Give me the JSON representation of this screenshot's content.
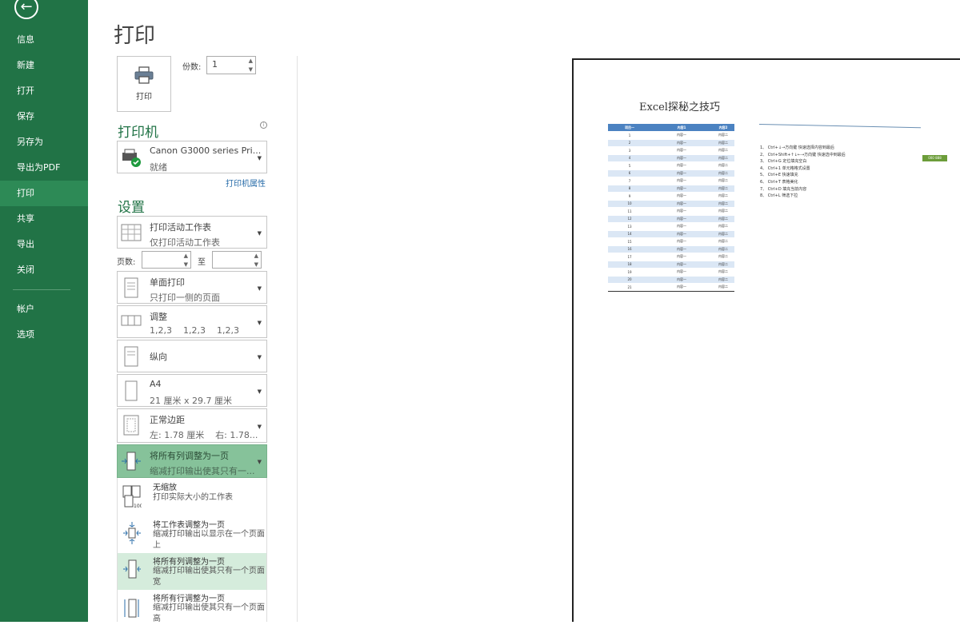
{
  "sidebar": {
    "items": [
      {
        "label": "信息"
      },
      {
        "label": "新建"
      },
      {
        "label": "打开"
      },
      {
        "label": "保存"
      },
      {
        "label": "另存为"
      },
      {
        "label": "导出为PDF"
      },
      {
        "label": "打印",
        "active": true
      },
      {
        "label": "共享"
      },
      {
        "label": "导出"
      },
      {
        "label": "关闭"
      },
      {
        "label": "帐户"
      },
      {
        "label": "选项"
      }
    ]
  },
  "page_title": "打印",
  "print_button_label": "打印",
  "copies": {
    "label": "份数:",
    "value": "1"
  },
  "printer": {
    "section_title": "打印机",
    "name": "Canon G3000 series Pri...",
    "status": "就绪",
    "properties_link": "打印机属性"
  },
  "settings": {
    "section_title": "设置",
    "scope": {
      "title": "打印活动工作表",
      "desc": "仅打印活动工作表"
    },
    "pages_label": "页数:",
    "to_label": "至",
    "sides": {
      "title": "单面打印",
      "desc": "只打印一侧的页面"
    },
    "collate": {
      "title": "调整",
      "desc": "1,2,3    1,2,3    1,2,3"
    },
    "orientation": {
      "title": "纵向"
    },
    "paper": {
      "title": "A4",
      "desc": "21 厘米 x 29.7 厘米"
    },
    "margins": {
      "title": "正常边距",
      "desc": "左: 1.78 厘米    右: 1.78..."
    },
    "scaling": {
      "title": "将所有列调整为一页",
      "desc": "缩减打印输出使其只有一..."
    }
  },
  "scaling_menu": [
    {
      "title": "无缩放",
      "desc": "打印实际大小的工作表"
    },
    {
      "title": "将工作表调整为一页",
      "desc": "缩减打印输出以显示在一个页面上"
    },
    {
      "title": "将所有列调整为一页",
      "desc": "缩减打印输出使其只有一个页面宽",
      "selected": true
    },
    {
      "title": "将所有行调整为一页",
      "desc": "缩减打印输出使其只有一个页面高"
    }
  ],
  "preview": {
    "title": "Excel探秘之技巧",
    "headers": [
      "项目一",
      "内容1",
      "内容2"
    ],
    "rows": [
      [
        "1",
        "内容一",
        "内容二"
      ],
      [
        "2",
        "内容一",
        "内容二"
      ],
      [
        "3",
        "内容一",
        "内容二"
      ],
      [
        "4",
        "内容一",
        "内容二"
      ],
      [
        "5",
        "内容一",
        "内容二"
      ],
      [
        "6",
        "内容一",
        "内容二"
      ],
      [
        "7",
        "内容一",
        "内容二"
      ],
      [
        "8",
        "内容一",
        "内容二"
      ],
      [
        "9",
        "内容一",
        "内容二"
      ],
      [
        "10",
        "内容一",
        "内容二"
      ],
      [
        "11",
        "内容一",
        "内容二"
      ],
      [
        "12",
        "内容一",
        "内容二"
      ],
      [
        "13",
        "内容一",
        "内容二"
      ],
      [
        "14",
        "内容一",
        "内容二"
      ],
      [
        "15",
        "内容一",
        "内容二"
      ],
      [
        "16",
        "内容一",
        "内容二"
      ],
      [
        "17",
        "内容一",
        "内容二"
      ],
      [
        "18",
        "内容一",
        "内容二"
      ],
      [
        "19",
        "内容一",
        "内容二"
      ],
      [
        "20",
        "内容一",
        "内容二"
      ],
      [
        "21",
        "内容一",
        "内容二"
      ]
    ],
    "notes": [
      "1、 Ctrl+↓→方向键 快速选择内容到最后",
      "2、 Ctrl+Shift+↑↓←→方向键 快速选中到最后",
      "3、 Ctrl+G 定位填充空白",
      "4、 Ctrl+1 单元格格式设置",
      "5、 Ctrl+E 快速填充",
      "6、 Ctrl+T 表格美化",
      "7、 Ctrl+D 填充当前内容",
      "8、 Ctrl+L 筛选下拉"
    ],
    "green_cell": "000 888"
  }
}
